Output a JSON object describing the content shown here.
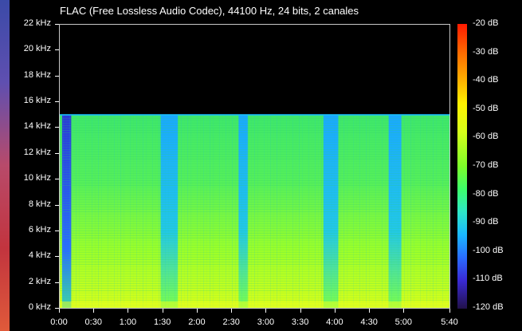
{
  "title": "FLAC (Free Lossless Audio Codec), 44100 Hz, 24 bits, 2 canales",
  "y_axis": {
    "labels": [
      "22 kHz",
      "20 kHz",
      "18 kHz",
      "16 kHz",
      "14 kHz",
      "12 kHz",
      "10 kHz",
      "8 kHz",
      "6 kHz",
      "4 kHz",
      "2 kHz",
      "0 kHz"
    ]
  },
  "x_axis": {
    "labels": [
      "0:00",
      "0:30",
      "1:00",
      "1:30",
      "2:00",
      "2:30",
      "3:00",
      "3:30",
      "4:00",
      "4:30",
      "5:00",
      "5:40"
    ]
  },
  "colorbar": {
    "labels": [
      "-20 dB",
      "-30 dB",
      "-40 dB",
      "-50 dB",
      "-60 dB",
      "-70 dB",
      "-80 dB",
      "-90 dB",
      "-100 dB",
      "-110 dB",
      "-120 dB"
    ]
  },
  "spectrogram": {
    "duration_s": 340,
    "max_freq_khz": 22,
    "cutoff_khz": 15,
    "quiet_segments_s": [
      [
        2,
        10
      ],
      [
        88,
        103
      ],
      [
        156,
        164
      ],
      [
        230,
        243
      ],
      [
        287,
        298
      ]
    ]
  },
  "colors": {
    "background": "#000000",
    "loud": "#9cff2a",
    "mid": "#3fe86a",
    "quiet": "#1aa8ff",
    "silent": "#2a2ad0"
  }
}
